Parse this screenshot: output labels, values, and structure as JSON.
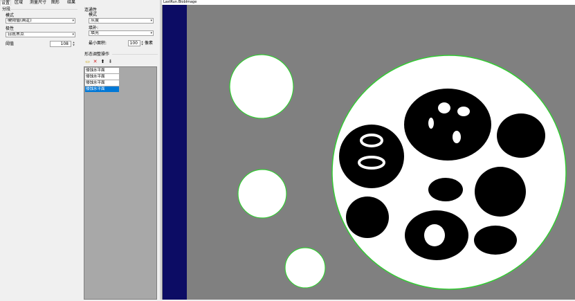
{
  "tabs": [
    "设置",
    "区域",
    "测量尺寸",
    "图形",
    "结果"
  ],
  "segmentation": {
    "group_title": "分段",
    "mode_label": "模式",
    "mode_value": "硬阈值(固定)",
    "polarity_label": "极性",
    "polarity_value": "白底黑点",
    "threshold_label": "阈值",
    "threshold_value": "108"
  },
  "connectivity": {
    "group_title": "连通性",
    "mode_label": "模式",
    "mode_value": "灰度",
    "fill_label": "填补:",
    "fill_value": "填充",
    "min_area_label": "最小面积:",
    "min_area_value": "100",
    "min_area_unit": "像素"
  },
  "morphology": {
    "group_title": "形态调整操作",
    "toolbar_icons": [
      "add-icon",
      "delete-icon",
      "move-up-icon",
      "move-down-icon"
    ],
    "operations": [
      "侵蚀水平面",
      "侵蚀水平面",
      "侵蚀水平面",
      "侵蚀水平面"
    ],
    "selected_index": 3
  },
  "image_view": {
    "title": "LastRun.BlobImage",
    "background_color": "#808080",
    "edge_band_color": "#0c0c64",
    "blob_outline_color": "#33cc33"
  }
}
